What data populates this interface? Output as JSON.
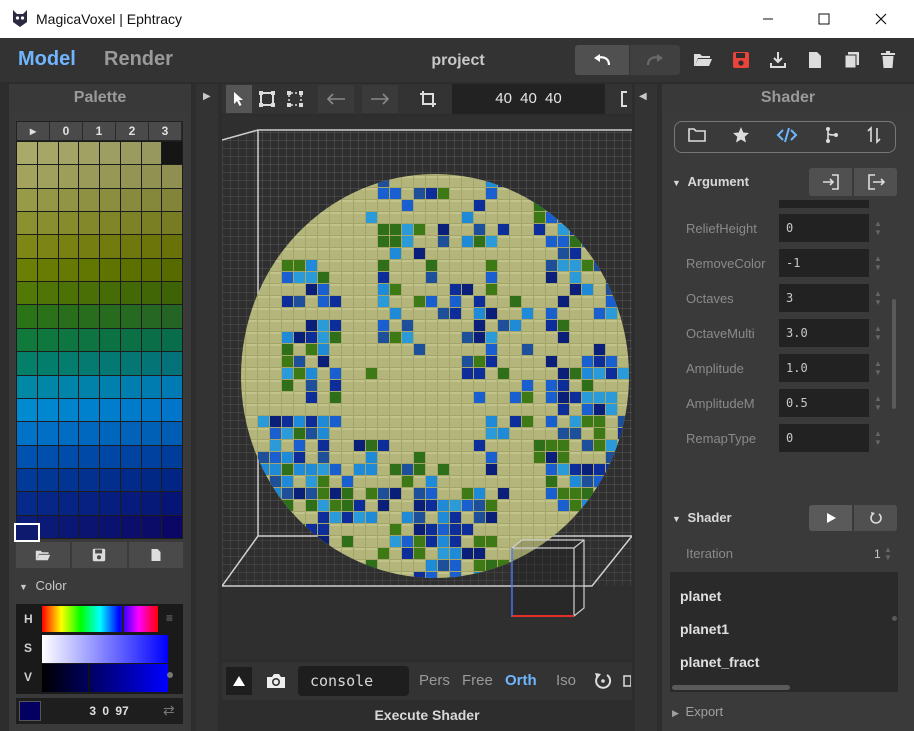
{
  "window": {
    "title": "MagicaVoxel | Ephtracy",
    "minimize": "—",
    "maximize": "☐",
    "close": "✕"
  },
  "appbar": {
    "tabs": [
      {
        "label": "Model",
        "active": true
      },
      {
        "label": "Render",
        "active": false
      }
    ],
    "project_name": "project"
  },
  "palette": {
    "title": "Palette",
    "tabs": [
      "▸",
      "0",
      "1",
      "2",
      "3"
    ],
    "rows": [
      [
        "#a9a969",
        "#a6a667",
        "#a3a465",
        "#a0a163",
        "#9d9e61",
        "#9a9b5f",
        "#97985d",
        "#151515"
      ],
      [
        "#a3a35e",
        "#a0a15c",
        "#9d9e5a",
        "#9a9b58",
        "#979856",
        "#949554",
        "#919252",
        "#8e8f50"
      ],
      [
        "#979a47",
        "#949745",
        "#919443",
        "#8e9141",
        "#8b8e3f",
        "#888b3d",
        "#85883b",
        "#828539"
      ],
      [
        "#8c9130",
        "#898e2e",
        "#868b2c",
        "#83882a",
        "#808528",
        "#7d8226",
        "#7a7f24",
        "#777c22"
      ],
      [
        "#7e8716",
        "#7b8414",
        "#788112",
        "#757e10",
        "#727b0e",
        "#6f780c",
        "#6c750a",
        "#697208"
      ],
      [
        "#6b7f05",
        "#687c04",
        "#657903",
        "#627602",
        "#5f7301",
        "#5c7000",
        "#596d00",
        "#566a00"
      ],
      [
        "#527806",
        "#4f7506",
        "#4c7206",
        "#496f06",
        "#466c06",
        "#436906",
        "#406606",
        "#3d6306"
      ],
      [
        "#2b7317",
        "#2a7119",
        "#296f1b",
        "#286d1d",
        "#276b1f",
        "#266921",
        "#256723",
        "#246525"
      ],
      [
        "#107a3c",
        "#0f783e",
        "#0e7640",
        "#0d7442",
        "#0c7244",
        "#0b7046",
        "#0a6e48",
        "#096c4a"
      ],
      [
        "#04806a",
        "#047e6c",
        "#047c6e",
        "#047a70",
        "#047872",
        "#047674",
        "#047476",
        "#047278"
      ],
      [
        "#0088a5",
        "#0086a7",
        "#0084a9",
        "#0082ab",
        "#0080ad",
        "#007eaf",
        "#007cb1",
        "#007ab3"
      ],
      [
        "#008ad0",
        "#0087cf",
        "#0084ce",
        "#0081cd",
        "#007ecc",
        "#007bcb",
        "#0078ca",
        "#0075c9"
      ],
      [
        "#0072c8",
        "#006fc5",
        "#006cc2",
        "#0069bf",
        "#0066bc",
        "#0063b9",
        "#0060b6",
        "#005db3"
      ],
      [
        "#0052b0",
        "#004fad",
        "#004caa",
        "#0049a7",
        "#0046a4",
        "#0043a1",
        "#00409e",
        "#003d9b"
      ],
      [
        "#023a98",
        "#023795",
        "#023492",
        "#02318f",
        "#022e8c",
        "#022b89",
        "#022886",
        "#022583"
      ],
      [
        "#062a8a",
        "#062787",
        "#062484",
        "#062181",
        "#061e7e",
        "#061b7b",
        "#061878",
        "#061575"
      ],
      [
        "#0b1d7a",
        "#0b1a77",
        "#0b1774",
        "#0b1471",
        "#0b116e",
        "#0b0e6b",
        "#0b0b68",
        "#0b0865"
      ]
    ],
    "file_buttons": [
      "open-icon",
      "save-icon",
      "new-icon"
    ]
  },
  "color": {
    "section_label": "Color",
    "h_label": "H",
    "s_label": "S",
    "v_label": "V",
    "value": "3 0 97",
    "swatch": "#030061"
  },
  "viewport": {
    "size_value": "40 40 40",
    "bottom": {
      "console_label": "console",
      "views": [
        {
          "label": "Pers",
          "active": false
        },
        {
          "label": "Free",
          "active": false
        },
        {
          "label": "Orth",
          "active": true
        },
        {
          "label": "Iso",
          "active": false
        }
      ]
    },
    "execute_label": "Execute Shader"
  },
  "shader": {
    "title": "Shader",
    "argument_label": "Argument",
    "args": [
      {
        "name": "ReliefHeight",
        "value": "0"
      },
      {
        "name": "RemoveColor",
        "value": "-1"
      },
      {
        "name": "Octaves",
        "value": "3"
      },
      {
        "name": "OctaveMulti",
        "value": "3.0"
      },
      {
        "name": "Amplitude",
        "value": "1.0"
      },
      {
        "name": "AmplitudeM",
        "value": "0.5"
      },
      {
        "name": "RemapType",
        "value": "0"
      }
    ],
    "shader_section_label": "Shader",
    "iteration_label": "Iteration",
    "iteration_value": "1",
    "list": [
      "planet",
      "planet1",
      "planet_fract"
    ],
    "export_label": "Export"
  },
  "colors": {
    "accent": "#6fb6ff",
    "save_red": "#e8443a",
    "panel": "#3a3a3a"
  }
}
